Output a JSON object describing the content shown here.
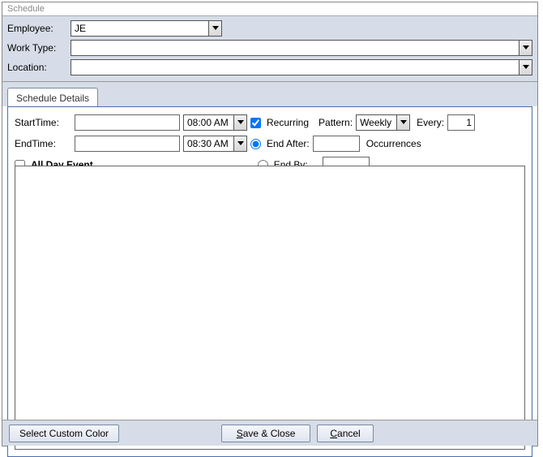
{
  "window": {
    "title": "Schedule"
  },
  "header": {
    "employee_label": "Employee:",
    "employee_value": "JE",
    "worktype_label": "Work Type:",
    "worktype_value": "",
    "location_label": "Location:",
    "location_value": ""
  },
  "tabs": {
    "schedule_details": "Schedule Details"
  },
  "details": {
    "starttime_label": "StartTime:",
    "starttime_date": "",
    "starttime_time": "08:00 AM",
    "endtime_label": "EndTime:",
    "endtime_date": "",
    "endtime_time": "08:30 AM",
    "allday_label": "All Day Event",
    "recurring_label": "Recurring",
    "pattern_label": "Pattern:",
    "pattern_value": "Weekly",
    "every_label": "Every:",
    "every_value": "1",
    "endafter_label": "End After:",
    "endafter_value": "",
    "occurrences_label": "Occurrences",
    "endby_label": "End By:",
    "endby_value": ""
  },
  "footer": {
    "custom_color": "Select Custom Color",
    "save_prefix": "S",
    "save_suffix": "ave & Close",
    "cancel_prefix": "C",
    "cancel_suffix": "ancel"
  }
}
